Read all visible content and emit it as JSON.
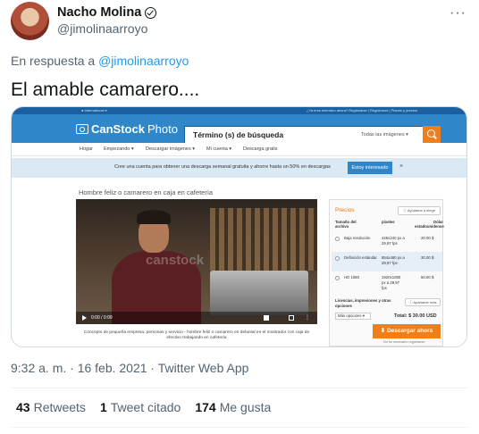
{
  "tweet": {
    "display_name": "Nacho Molina",
    "handle": "@jimolinaarroyo",
    "more_icon": "···",
    "reply_prefix": "En respuesta a",
    "reply_handle": "@jimolinaarroyo",
    "text": "El amable camarero....",
    "timestamp": "9:32 a. m. · 16 feb. 2021 · Twitter Web App",
    "stats": [
      {
        "count": "43",
        "label": "Retweets"
      },
      {
        "count": "1",
        "label": "Tweet citado"
      },
      {
        "count": "174",
        "label": "Me gusta"
      }
    ]
  },
  "screenshot": {
    "topbar_left": "● International ▾",
    "topbar_right": "¿Ya eres miembro ahora?  Registrarse  |  Registrarse  |  Planes y precios",
    "logo_text": "CanStock",
    "logo_suffix": "Photo",
    "search_placeholder": "Término (s) de búsqueda",
    "search_filter": "Todas las imágenes ▾",
    "nav": [
      "Hogar",
      "Empezando ▾",
      "Descargar imágenes ▾",
      "Mi cuenta ▾",
      "Descarga gratis"
    ],
    "banner_text": "Cree una cuenta para obtener una descarga semanal gratuita y ahorre hasta un 50% en descargas",
    "banner_button": "Estoy interesado",
    "banner_close": "×",
    "image_title": "Hombre feliz o camarero en caja en cafetería",
    "watermark": "canstock",
    "video_time": "0:00 / 0:09",
    "video_menu": "⋮",
    "caption": "Concepto de pequeña empresa, personas y servicio - hombre feliz o camarero en delantal en el mostrador con caja de efectivo trabajando en cafetería",
    "panel": {
      "title": "Precios",
      "help": "ⓘ Ayúdame a elegir",
      "headers": [
        "Tamaño del archivo",
        "píxeles",
        "Dólar estadounidense"
      ],
      "rows": [
        {
          "name": "Baja resolución",
          "pixels": "426x240 px a 29,97 fps",
          "price": "20.00 $"
        },
        {
          "name": "Definición estándar",
          "pixels": "854x480 px a 29,97 fps",
          "price": "30.00 $"
        },
        {
          "name": "HD 1080",
          "pixels": "1920x1080 px a 29,97 fps",
          "price": "50.00 $"
        }
      ],
      "license_label": "Licencias, impresiones y otras opciones",
      "help2": "ⓘ Apártame más",
      "options": "Más opciones ▾",
      "total": "Total: $ 30.00 USD",
      "download": "⬇ Descargar ahora",
      "note": "No es necesario registrarse"
    }
  }
}
